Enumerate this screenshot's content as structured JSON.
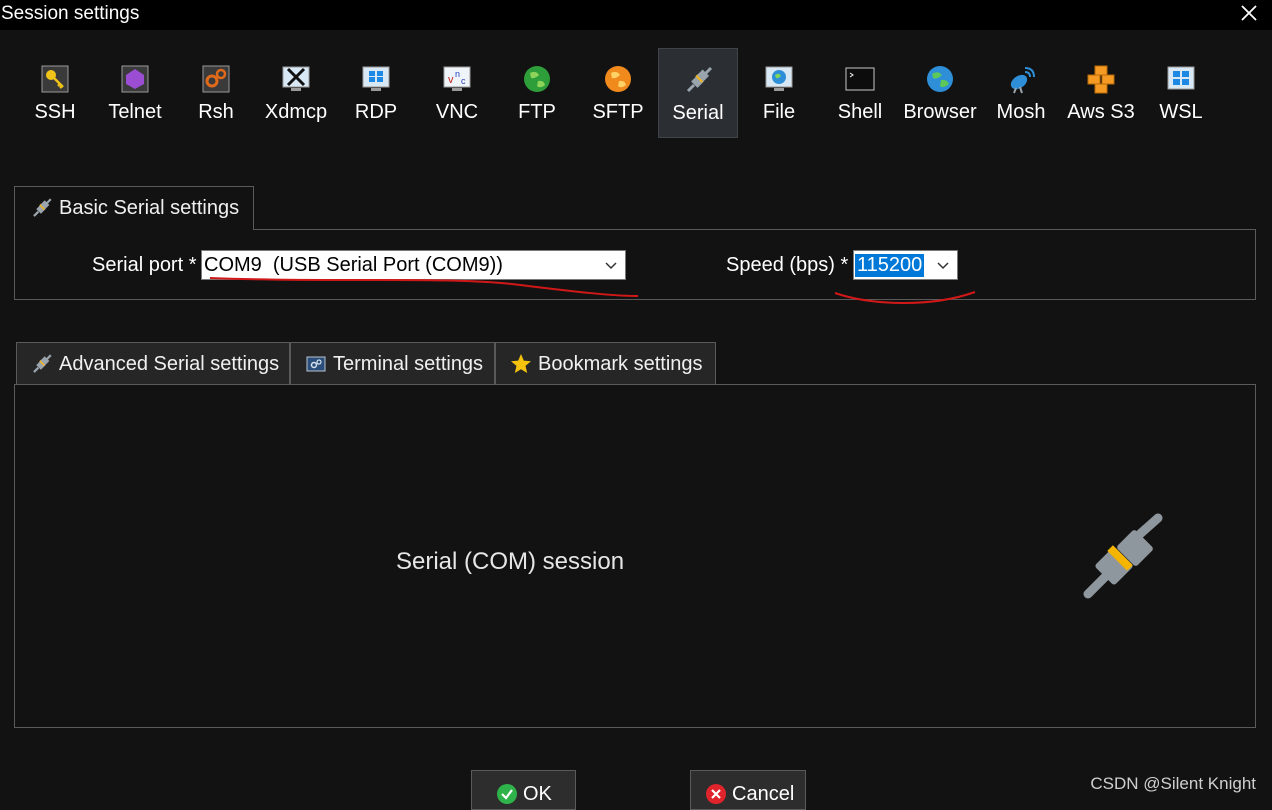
{
  "window": {
    "title": "Session settings"
  },
  "protocols": [
    {
      "label": "SSH",
      "icon": "ssh-key-icon"
    },
    {
      "label": "Telnet",
      "icon": "telnet-icon"
    },
    {
      "label": "Rsh",
      "icon": "rsh-icon"
    },
    {
      "label": "Xdmcp",
      "icon": "xdmcp-icon"
    },
    {
      "label": "RDP",
      "icon": "rdp-icon"
    },
    {
      "label": "VNC",
      "icon": "vnc-icon"
    },
    {
      "label": "FTP",
      "icon": "ftp-globe-icon"
    },
    {
      "label": "SFTP",
      "icon": "sftp-globe-icon"
    },
    {
      "label": "Serial",
      "icon": "serial-plug-icon"
    },
    {
      "label": "File",
      "icon": "file-monitor-icon"
    },
    {
      "label": "Shell",
      "icon": "shell-terminal-icon"
    },
    {
      "label": "Browser",
      "icon": "browser-globe-icon"
    },
    {
      "label": "Mosh",
      "icon": "mosh-satellite-icon"
    },
    {
      "label": "Aws S3",
      "icon": "aws-s3-icon"
    },
    {
      "label": "WSL",
      "icon": "wsl-windows-icon"
    }
  ],
  "selected_protocol": "Serial",
  "basic": {
    "tab_label": "Basic Serial settings",
    "serial_port_label": "Serial port *",
    "serial_port_value": "COM9  (USB Serial Port (COM9))",
    "speed_label": "Speed (bps) *",
    "speed_value": "115200"
  },
  "advanced_tabs": [
    {
      "label": "Advanced Serial settings",
      "icon": "serial-plug-icon"
    },
    {
      "label": "Terminal settings",
      "icon": "terminal-settings-icon"
    },
    {
      "label": "Bookmark settings",
      "icon": "star-icon"
    }
  ],
  "panel": {
    "caption": "Serial (COM) session",
    "icon": "serial-plug-icon"
  },
  "buttons": {
    "ok": "OK",
    "cancel": "Cancel"
  },
  "watermark": "CSDN @Silent Knight",
  "colors": {
    "background": "#121212",
    "accent": "#0078d7",
    "annotation": "#d01818"
  }
}
